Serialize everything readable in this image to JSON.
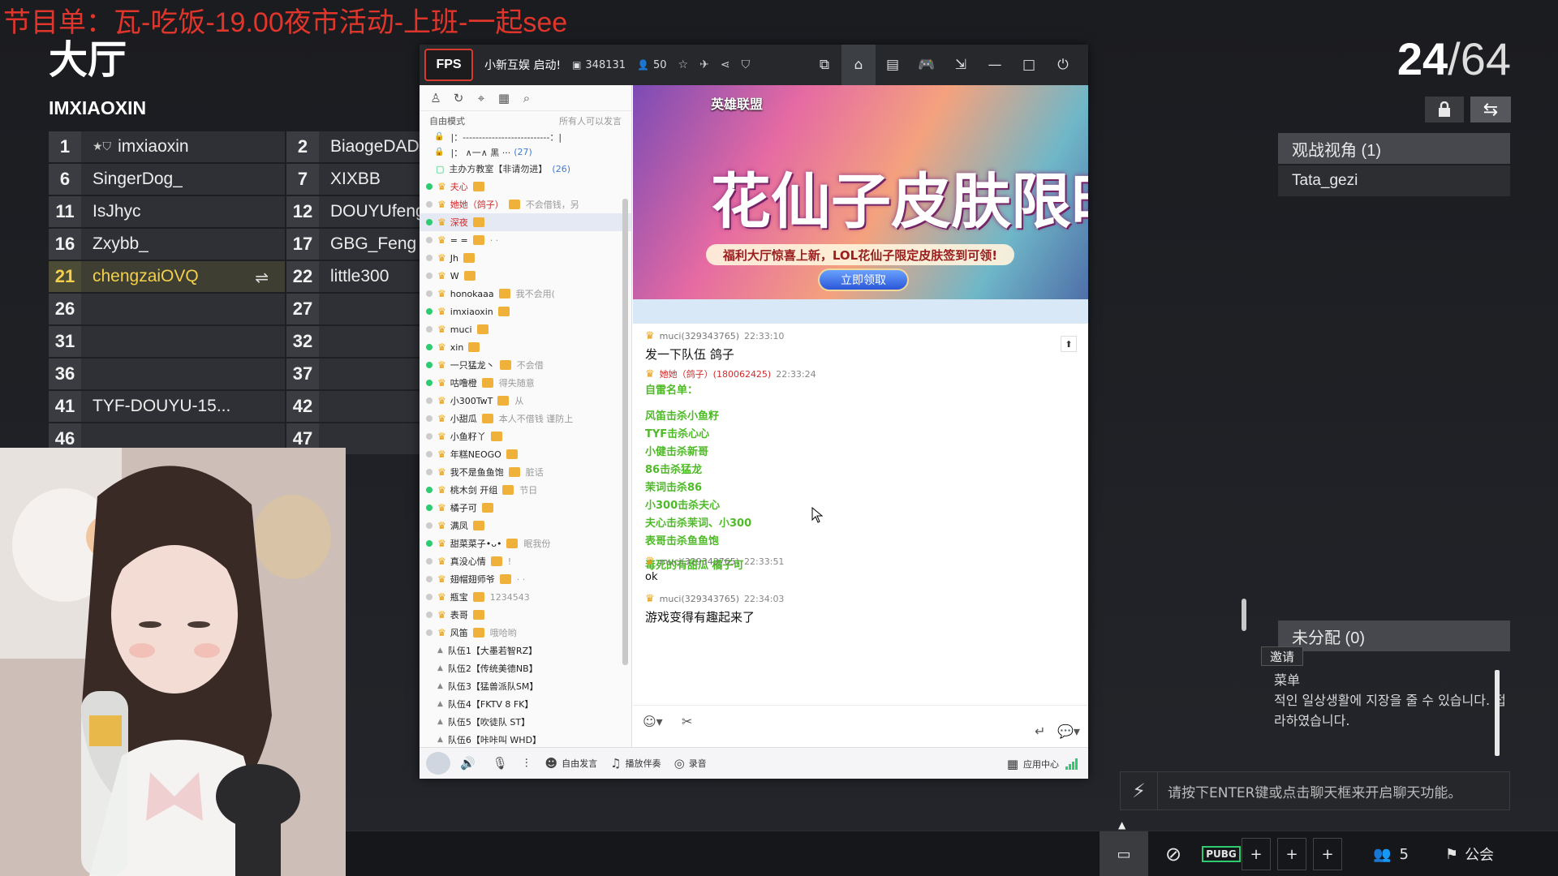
{
  "banner_text": "节目单：瓦-吃饭-19.00夜市活动-上班-一起see",
  "lobby": {
    "title": "大厅",
    "room_name": "IMXIAOXIN",
    "counter_current": "24",
    "counter_total": "/64",
    "slots": [
      {
        "n": "1",
        "name": "imxiaoxin"
      },
      {
        "n": "2",
        "name": "BiaogeDADA"
      },
      {
        "n": "6",
        "name": "SingerDog_"
      },
      {
        "n": "7",
        "name": "XIXBB"
      },
      {
        "n": "11",
        "name": "IsJhyc"
      },
      {
        "n": "12",
        "name": "DOUYUfengd"
      },
      {
        "n": "16",
        "name": "Zxybb_"
      },
      {
        "n": "17",
        "name": "GBG_Feng"
      },
      {
        "n": "21",
        "name": "chengzaiOVQ"
      },
      {
        "n": "22",
        "name": "little300"
      },
      {
        "n": "26",
        "name": ""
      },
      {
        "n": "27",
        "name": ""
      },
      {
        "n": "31",
        "name": ""
      },
      {
        "n": "32",
        "name": ""
      },
      {
        "n": "36",
        "name": ""
      },
      {
        "n": "37",
        "name": ""
      },
      {
        "n": "41",
        "name": "TYF-DOUYU-15..."
      },
      {
        "n": "42",
        "name": ""
      },
      {
        "n": "46",
        "name": ""
      },
      {
        "n": "47",
        "name": ""
      }
    ],
    "spectator_header": "观战视角 (1)",
    "spectator_name": "Tata_gezi",
    "unassigned_header": "未分配 (0)",
    "invite_label": "邀请",
    "chat_lines": [
      "菜单",
      "적인 일상생활에 지장을 줄 수 있습니다. 접",
      "라하였습니다."
    ],
    "chat_prompt": "请按下ENTER键或点击聊天框来开启聊天功能。",
    "bottom": {
      "online_count": "5",
      "guild_label": "公会"
    }
  },
  "yy": {
    "channel_name": "小新互娱 启动!",
    "channel_id": "348131",
    "online": "50",
    "left_mode": "自由模式",
    "left_mode_right": "所有人可以发言",
    "lock_rows": [
      "|：---------------------------：|",
      "|：       ∧一∧     黑         ··· "
    ],
    "lock_row2_count": "(27)",
    "sub_channel": "主办方教室【非请勿进】",
    "sub_channel_count": "(26)",
    "members": [
      {
        "name": "夫心",
        "red": true,
        "sig": "",
        "on": true
      },
      {
        "name": "她她（鸽子）",
        "red": true,
        "sig": "不会借钱，另",
        "on": false
      },
      {
        "name": "深夜",
        "red": true,
        "sig": "",
        "on": true,
        "sel": true
      },
      {
        "name": "= =",
        "red": false,
        "sig": "· ·",
        "on": false
      },
      {
        "name": "Jh",
        "red": false,
        "sig": "",
        "on": false
      },
      {
        "name": "W",
        "red": false,
        "sig": "",
        "on": false
      },
      {
        "name": "honokaaa",
        "red": false,
        "sig": "我不会用(",
        "on": false
      },
      {
        "name": "imxiaoxin",
        "red": false,
        "sig": "",
        "on": true
      },
      {
        "name": "muci",
        "red": false,
        "sig": "",
        "on": false
      },
      {
        "name": "xin",
        "red": false,
        "sig": "",
        "on": true
      },
      {
        "name": "一只猛龙丶",
        "red": false,
        "sig": "不会借",
        "on": true
      },
      {
        "name": "咕噜橙",
        "red": false,
        "sig": "得失随意",
        "on": true
      },
      {
        "name": "小300TwT",
        "red": false,
        "sig": "从",
        "on": false
      },
      {
        "name": "小甜瓜",
        "red": false,
        "sig": "本人不借钱 谨防上",
        "on": false
      },
      {
        "name": "小鱼籽丫",
        "red": false,
        "sig": "",
        "on": false
      },
      {
        "name": "年糕NEOGO",
        "red": false,
        "sig": "",
        "on": false
      },
      {
        "name": "我不是鱼鱼饱",
        "red": false,
        "sig": "脏话",
        "on": false
      },
      {
        "name": "桃木剑 开组",
        "red": false,
        "sig": "节日",
        "on": true
      },
      {
        "name": "橘子可",
        "red": false,
        "sig": "",
        "on": true
      },
      {
        "name": "满凤",
        "red": false,
        "sig": "",
        "on": false
      },
      {
        "name": "甜菜菜子•ᴗ•",
        "red": false,
        "sig": "眠我份",
        "on": true
      },
      {
        "name": "真没心情",
        "red": false,
        "sig": "!",
        "on": false
      },
      {
        "name": "翅帽翅师爷",
        "red": false,
        "sig": "· ·",
        "on": false
      },
      {
        "name": "瓶宝",
        "red": false,
        "sig": "1234543",
        "on": false
      },
      {
        "name": "表哥",
        "red": false,
        "sig": "",
        "on": false
      },
      {
        "name": "风笛",
        "red": false,
        "sig": "哦哈哟",
        "on": false
      }
    ],
    "teams": [
      "队伍1【大墨若智RZ】",
      "队伍2【传统美德NB】",
      "队伍3【猛兽派队SM】",
      "队伍4【FKTV 8   FK】",
      "队伍5【吹徒队   ST】",
      "队伍6【咔咔叫  WHD】"
    ],
    "ad": {
      "brand": "英雄联盟",
      "title": "花仙子皮肤限时领",
      "sub": "福利大厅惊喜上新，LOL花仙子限定皮肤签到可领!",
      "button": "立即领取"
    },
    "messages": {
      "m1_user": "muci(329343765)",
      "m1_time": "22:33:10",
      "m1_text": "发一下队伍 鸽子",
      "m2_user": "她她（鸽子）(180062425)",
      "m2_time": "22:33:24",
      "m2_title": "自雷名单：",
      "m2_lines": [
        "风笛击杀小鱼籽",
        "TYF击杀心心",
        "小健击杀新哥",
        "86击杀猛龙",
        "茉词击杀86",
        "小300击杀夫心",
        "夫心击杀茉词、小300",
        "表哥击杀鱼鱼饱"
      ],
      "m2_footer": "毒死的有甜瓜   橘子可",
      "m3_user": "muci(329343765)",
      "m3_time": "22:33:51",
      "m3_text": "ok",
      "m4_user": "muci(329343765)",
      "m4_time": "22:34:03",
      "m4_text": "游戏变得有趣起来了"
    },
    "bottom": {
      "free_speech": "自由发言",
      "accompany": "播放伴奏",
      "record": "录音",
      "app_center": "应用中心"
    }
  }
}
